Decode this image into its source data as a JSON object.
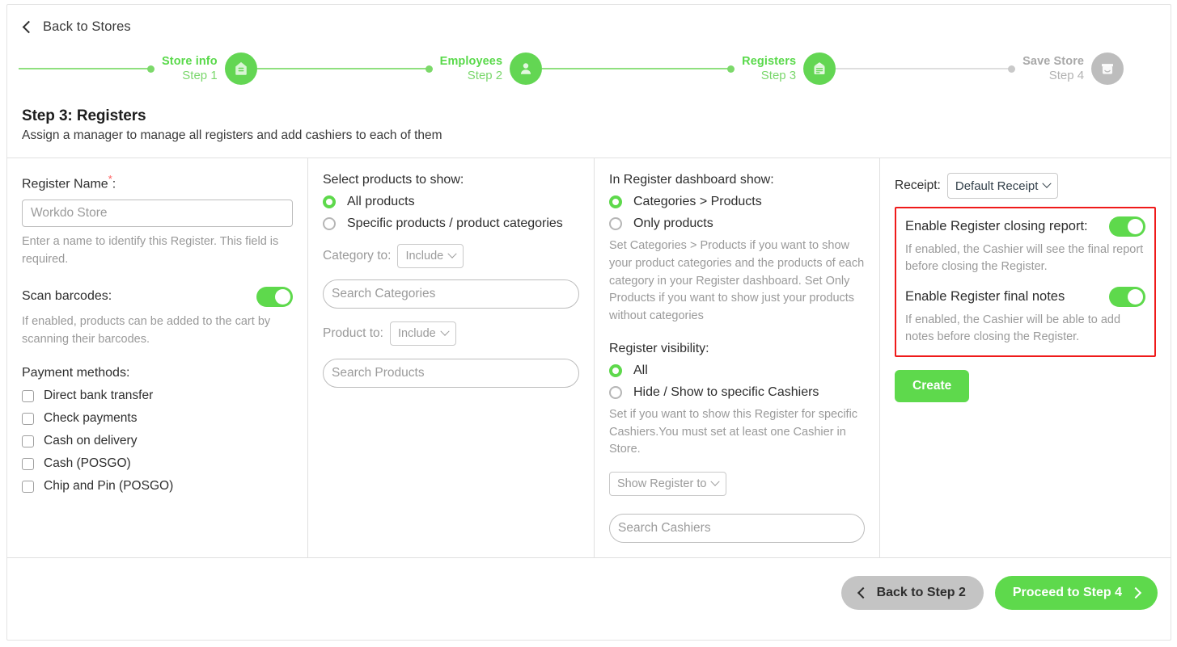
{
  "back_link": {
    "label": "Back to Stores",
    "icon": "chevron-left-icon"
  },
  "stepper": {
    "steps": [
      {
        "title": "Store info",
        "sub": "Step 1",
        "icon": "store-icon",
        "state": "done"
      },
      {
        "title": "Employees",
        "sub": "Step 2",
        "icon": "user-icon",
        "state": "done"
      },
      {
        "title": "Registers",
        "sub": "Step 3",
        "icon": "register-receipt-icon",
        "state": "active"
      },
      {
        "title": "Save Store",
        "sub": "Step 4",
        "icon": "shop-face-icon",
        "state": "upcoming"
      }
    ],
    "active_color": "#5ed94c",
    "inactive_color": "#bdbdbd"
  },
  "heading": {
    "title": "Step 3: Registers",
    "subtitle": "Assign a manager to manage all registers and add cashiers to each of them"
  },
  "col_register": {
    "name_label": "Register Name",
    "required_mark": "*",
    "name_colon": ":",
    "name_placeholder": "Workdo Store",
    "name_value": "",
    "name_help": "Enter a name to identify this Register. This field is required.",
    "scan_label": "Scan barcodes:",
    "scan_enabled": true,
    "scan_help": "If enabled, products can be added to the cart by scanning their barcodes.",
    "payment_label": "Payment methods:",
    "payment_methods": [
      {
        "label": "Direct bank transfer",
        "checked": false
      },
      {
        "label": "Check payments",
        "checked": false
      },
      {
        "label": "Cash on delivery",
        "checked": false
      },
      {
        "label": "Cash (POSGO)",
        "checked": false
      },
      {
        "label": "Chip and Pin (POSGO)",
        "checked": false
      }
    ]
  },
  "col_products": {
    "title": "Select products to show:",
    "options": [
      {
        "label": "All products",
        "selected": true
      },
      {
        "label": "Specific products / product categories",
        "selected": false
      }
    ],
    "category_to_label": "Category to:",
    "category_to_value": "Include",
    "category_search_placeholder": "Search Categories",
    "product_to_label": "Product to:",
    "product_to_value": "Include",
    "product_search_placeholder": "Search Products"
  },
  "col_dashboard": {
    "title": "In Register dashboard show:",
    "options": [
      {
        "label": "Categories > Products",
        "selected": true
      },
      {
        "label": "Only products",
        "selected": false
      }
    ],
    "help": "Set Categories > Products if you want to show your product categories and the products of each category in your Register dashboard. Set Only Products if you want to show just your products without categories",
    "visibility_title": "Register visibility:",
    "visibility_options": [
      {
        "label": "All",
        "selected": true
      },
      {
        "label": "Hide / Show to specific Cashiers",
        "selected": false
      }
    ],
    "visibility_help": "Set if you want to show this Register for specific Cashiers.You must set at least one Cashier in Store.",
    "show_register_to_value": "Show Register to",
    "cashier_search_placeholder": "Search Cashiers"
  },
  "col_receipt": {
    "receipt_label": "Receipt:",
    "receipt_value": "Default Receipt",
    "highlight_color": "#ef1a1a",
    "closing_report_label": "Enable Register closing report:",
    "closing_report_enabled": true,
    "closing_report_help": "If enabled, the Cashier will see the final report before closing the Register.",
    "final_notes_label": "Enable Register final notes",
    "final_notes_enabled": true,
    "final_notes_help": "If enabled, the Cashier will be able to add notes before closing the Register.",
    "create_label": "Create"
  },
  "footer": {
    "back_label": "Back to Step 2",
    "next_label": "Proceed to Step 4"
  }
}
